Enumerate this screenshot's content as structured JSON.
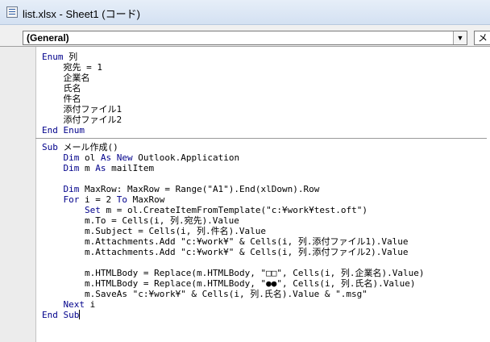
{
  "window": {
    "title": "list.xlsx - Sheet1 (コード)"
  },
  "toolbar": {
    "object_combo": "(General)",
    "proc_combo": "メ"
  },
  "code": {
    "enum_block": [
      [
        {
          "t": "Enum",
          "k": 1
        },
        {
          "t": " 列"
        }
      ],
      [
        {
          "t": "    宛先 = 1"
        }
      ],
      [
        {
          "t": "    企業名"
        }
      ],
      [
        {
          "t": "    氏名"
        }
      ],
      [
        {
          "t": "    件名"
        }
      ],
      [
        {
          "t": "    添付ファイル1"
        }
      ],
      [
        {
          "t": "    添付ファイル2"
        }
      ],
      [
        {
          "t": "End Enum",
          "k": 1
        }
      ]
    ],
    "sub_block": [
      [
        {
          "t": "Sub",
          "k": 1
        },
        {
          "t": " メール作成()"
        }
      ],
      [
        {
          "t": "    "
        },
        {
          "t": "Dim",
          "k": 1
        },
        {
          "t": " ol "
        },
        {
          "t": "As New",
          "k": 1
        },
        {
          "t": " Outlook.Application"
        }
      ],
      [
        {
          "t": "    "
        },
        {
          "t": "Dim",
          "k": 1
        },
        {
          "t": " m "
        },
        {
          "t": "As",
          "k": 1
        },
        {
          "t": " mailItem"
        }
      ],
      [
        {
          "t": ""
        }
      ],
      [
        {
          "t": "    "
        },
        {
          "t": "Dim",
          "k": 1
        },
        {
          "t": " MaxRow: MaxRow = Range(\"A1\").End(xlDown).Row"
        }
      ],
      [
        {
          "t": "    "
        },
        {
          "t": "For",
          "k": 1
        },
        {
          "t": " i = 2 "
        },
        {
          "t": "To",
          "k": 1
        },
        {
          "t": " MaxRow"
        }
      ],
      [
        {
          "t": "        "
        },
        {
          "t": "Set",
          "k": 1
        },
        {
          "t": " m = ol.CreateItemFromTemplate(\"c:¥work¥test.oft\")"
        }
      ],
      [
        {
          "t": "        m.To = Cells(i, 列.宛先).Value"
        }
      ],
      [
        {
          "t": "        m.Subject = Cells(i, 列.件名).Value"
        }
      ],
      [
        {
          "t": "        m.Attachments.Add \"c:¥work¥\" & Cells(i, 列.添付ファイル1).Value"
        }
      ],
      [
        {
          "t": "        m.Attachments.Add \"c:¥work¥\" & Cells(i, 列.添付ファイル2).Value"
        }
      ],
      [
        {
          "t": ""
        }
      ],
      [
        {
          "t": "        m.HTMLBody = Replace(m.HTMLBody, \"□□\", Cells(i, 列.企業名).Value)"
        }
      ],
      [
        {
          "t": "        m.HTMLBody = Replace(m.HTMLBody, \"●●\", Cells(i, 列.氏名).Value)"
        }
      ],
      [
        {
          "t": "        m.SaveAs \"c:¥work¥\" & Cells(i, 列.氏名).Value & \".msg\""
        }
      ],
      [
        {
          "t": "    "
        },
        {
          "t": "Next",
          "k": 1
        },
        {
          "t": " i"
        }
      ],
      [
        {
          "t": "End Sub",
          "k": 1
        }
      ]
    ]
  }
}
